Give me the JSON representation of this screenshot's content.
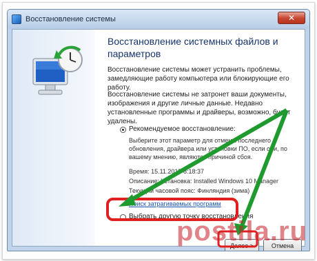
{
  "window": {
    "title": "Восстановление системы",
    "close_symbol": "✕"
  },
  "main": {
    "heading": "Восстановление системных файлов и параметров",
    "paragraph1": "Восстановление системы может устранить проблемы, замедляющие работу компьютера или блокирующие его работу.",
    "paragraph2": "Восстановление системы не затронет ваши документы, изображения и другие личные данные. Недавно установленные программы и драйверы, возможно, будут удалены.",
    "recommended": {
      "label": "Рекомендуемое восстановление:",
      "description": "Выберите этот параметр для отмены последнего обновления, драйвера или установки ПО, если они, по вашему мнению, являются причиной сбоя.",
      "time": "Время: 15.11.2015 8:18:37",
      "description_line": "Описание: Установка: Installed Windows 10 Manager",
      "timezone": "Текущий часовой пояс: Финляндия (зима)",
      "scan_link": "Поиск затрагиваемых программ"
    },
    "other_point": {
      "label": "Выбрать другую точку восстановления"
    }
  },
  "buttons": {
    "next": "Далее >",
    "cancel": "Отмена"
  },
  "watermark": "postila.ru",
  "colors": {
    "annotation_red": "#e02020",
    "arrow_green": "#1f9a2e",
    "heading_blue": "#16346b"
  },
  "icons": [
    "system-restore-icon",
    "close-icon"
  ]
}
